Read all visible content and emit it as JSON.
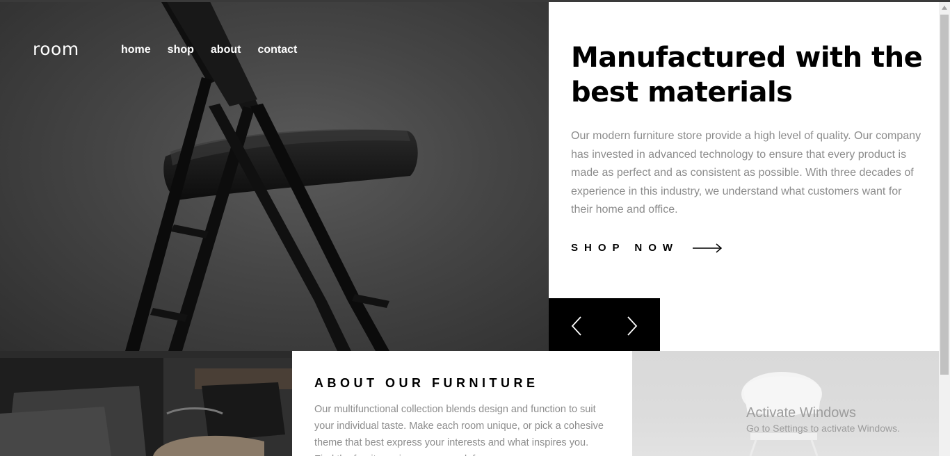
{
  "header": {
    "logo": "room",
    "nav": [
      "home",
      "shop",
      "about",
      "contact"
    ]
  },
  "hero": {
    "title": "Manufactured with the best materials",
    "description": "Our modern furniture store provide a high level of quality. Our company has invested in advanced technology to ensure that every product is made as perfect and as consistent as possible. With three decades of experience in this industry, we understand what customers want for their home and office.",
    "cta": "SHOP NOW"
  },
  "about": {
    "title": "ABOUT OUR FURNITURE",
    "description": "Our multifunctional collection blends design and function to suit your individual taste. Make each room unique, or pick a cohesive theme that best express your interests and what inspires you. Find the furniture pieces you need, from"
  },
  "watermark": {
    "line1": "Activate Windows",
    "line2": "Go to Settings to activate Windows."
  },
  "icons": {
    "prev": "angle-left-icon",
    "next": "angle-right-icon",
    "arrow": "arrow-right-icon"
  },
  "colors": {
    "accent": "#000000",
    "muted_text": "#8c8c8c",
    "hero_bg": "#454545"
  }
}
